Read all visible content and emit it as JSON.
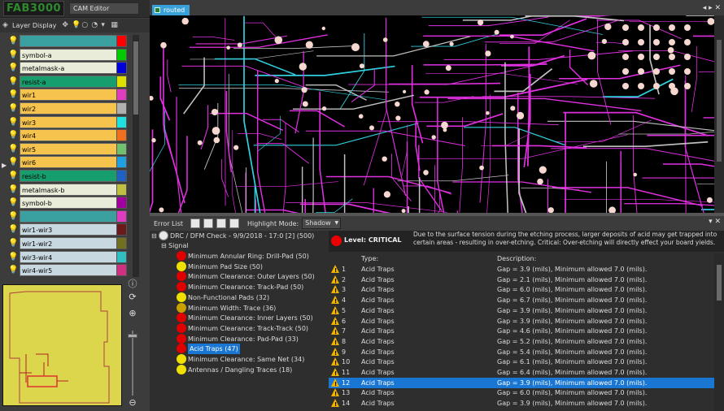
{
  "app": {
    "logo": "FAB3000",
    "mode": "CAM Editor"
  },
  "layer_panel": {
    "title": "Layer Display",
    "layers": [
      {
        "name": "",
        "bg": "#3aa0a0",
        "swatch": "#ff0000"
      },
      {
        "name": "symbol-a",
        "bg": "#e8ecd8",
        "swatch": "#00cc00"
      },
      {
        "name": "metalmask-a",
        "bg": "#e8ecd8",
        "swatch": "#0000dd"
      },
      {
        "name": "resist-a",
        "bg": "#169e6e",
        "swatch": "#e0e000"
      },
      {
        "name": "wir1",
        "bg": "#f6c44c",
        "swatch": "#e03cc0"
      },
      {
        "name": "wir2",
        "bg": "#f6c44c",
        "swatch": "#b0b0b0"
      },
      {
        "name": "wir3",
        "bg": "#f6c44c",
        "swatch": "#20e0e0"
      },
      {
        "name": "wir4",
        "bg": "#f6c44c",
        "swatch": "#f07020"
      },
      {
        "name": "wir5",
        "bg": "#f6c44c",
        "swatch": "#70c070"
      },
      {
        "name": "wir6",
        "bg": "#f6c44c",
        "swatch": "#20a0e0"
      },
      {
        "name": "resist-b",
        "bg": "#169e6e",
        "swatch": "#2060c0"
      },
      {
        "name": "metalmask-b",
        "bg": "#e8ecd8",
        "swatch": "#c0c040"
      },
      {
        "name": "symbol-b",
        "bg": "#e8ecd8",
        "swatch": "#a000a0"
      },
      {
        "name": "",
        "bg": "#3aa0a0",
        "swatch": "#e03cc0"
      },
      {
        "name": "wir1-wir3",
        "bg": "#c8d8e0",
        "swatch": "#6a1a1a"
      },
      {
        "name": "wir1-wir2",
        "bg": "#c8d8e0",
        "swatch": "#707020"
      },
      {
        "name": "wir3-wir4",
        "bg": "#c8d8e0",
        "swatch": "#30c0c0"
      },
      {
        "name": "wir4-wir5",
        "bg": "#c8d8e0",
        "swatch": "#d03080"
      }
    ]
  },
  "document_tab": {
    "label": "routed"
  },
  "error_list": {
    "title": "Error List",
    "highlight_label": "Highlight Mode:",
    "highlight_value": "Shadow",
    "check": "DRC / DFM Check - 9/9/2018 - 17:0 [2] (500)",
    "group": "Signal",
    "items": [
      {
        "label": "Minimum Annular Ring: Drill-Pad (50)",
        "color": "#e00000"
      },
      {
        "label": "Minimum Pad Size (50)",
        "color": "#f0e000"
      },
      {
        "label": "Minimum Clearance: Outer Layers (50)",
        "color": "#e00000"
      },
      {
        "label": "Minimum Clearance: Track-Pad (50)",
        "color": "#e00000"
      },
      {
        "label": "Non-Functional Pads (32)",
        "color": "#f0e000"
      },
      {
        "label": "Minimum Width: Trace (36)",
        "color": "#c8a000"
      },
      {
        "label": "Minimum Clearance: Inner Layers (50)",
        "color": "#e00000"
      },
      {
        "label": "Minimum Clearance: Track-Track (50)",
        "color": "#e00000"
      },
      {
        "label": "Minimum Clearance: Pad-Pad (33)",
        "color": "#e00000"
      },
      {
        "label": "Acid Traps (47)",
        "color": "#e00000",
        "selected": true
      },
      {
        "label": "Minimum Clearance: Same Net (34)",
        "color": "#f0e000"
      },
      {
        "label": "Antennas / Dangling Traces (18)",
        "color": "#f0e000"
      }
    ]
  },
  "detail": {
    "level": "Level: CRITICAL",
    "description": "Due to the surface tension during the etching process, larger deposits of acid may get trapped into certain areas - resulting in over-etching. Critical:  Over-etching will directly effect your board yields.",
    "col_type": "Type:",
    "col_desc": "Description:",
    "rows": [
      {
        "n": "1",
        "type": "Acid Traps",
        "desc": "Gap = 3.9 (mils), Minimum allowed 7.0 (mils)."
      },
      {
        "n": "2",
        "type": "Acid Traps",
        "desc": "Gap = 2.1 (mils), Minimum allowed 7.0 (mils)."
      },
      {
        "n": "3",
        "type": "Acid Traps",
        "desc": "Gap = 6.0 (mils), Minimum allowed 7.0 (mils)."
      },
      {
        "n": "4",
        "type": "Acid Traps",
        "desc": "Gap = 6.7 (mils), Minimum allowed 7.0 (mils)."
      },
      {
        "n": "5",
        "type": "Acid Traps",
        "desc": "Gap = 3.9 (mils), Minimum allowed 7.0 (mils)."
      },
      {
        "n": "6",
        "type": "Acid Traps",
        "desc": "Gap = 3.9 (mils), Minimum allowed 7.0 (mils)."
      },
      {
        "n": "7",
        "type": "Acid Traps",
        "desc": "Gap = 4.6 (mils), Minimum allowed 7.0 (mils)."
      },
      {
        "n": "8",
        "type": "Acid Traps",
        "desc": "Gap = 5.2 (mils), Minimum allowed 7.0 (mils)."
      },
      {
        "n": "9",
        "type": "Acid Traps",
        "desc": "Gap = 5.4 (mils), Minimum allowed 7.0 (mils)."
      },
      {
        "n": "10",
        "type": "Acid Traps",
        "desc": "Gap = 6.1 (mils), Minimum allowed 7.0 (mils)."
      },
      {
        "n": "11",
        "type": "Acid Traps",
        "desc": "Gap = 6.4 (mils), Minimum allowed 7.0 (mils)."
      },
      {
        "n": "12",
        "type": "Acid Traps",
        "desc": "Gap = 3.9 (mils), Minimum allowed 7.0 (mils).",
        "selected": true
      },
      {
        "n": "13",
        "type": "Acid Traps",
        "desc": "Gap = 6.0 (mils), Minimum allowed 7.0 (mils)."
      },
      {
        "n": "14",
        "type": "Acid Traps",
        "desc": "Gap = 3.9 (mils), Minimum allowed 7.0 (mils)."
      }
    ]
  }
}
